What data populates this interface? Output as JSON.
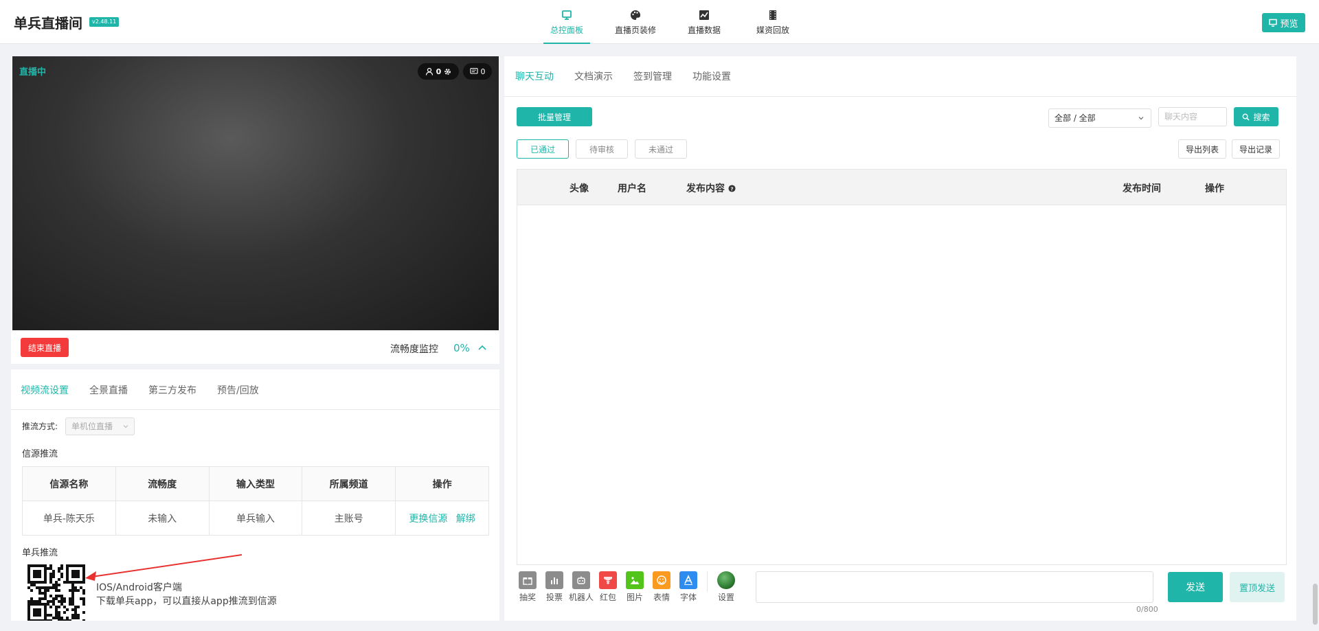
{
  "app": {
    "title": "单兵直播间",
    "version": "v2.48.11"
  },
  "nav": {
    "items": [
      {
        "label": "总控面板",
        "icon": "monitor-icon",
        "active": true
      },
      {
        "label": "直播页装修",
        "icon": "palette-icon",
        "active": false
      },
      {
        "label": "直播数据",
        "icon": "chart-icon",
        "active": false
      },
      {
        "label": "媒资回放",
        "icon": "film-icon",
        "active": false
      }
    ]
  },
  "header": {
    "preview_label": "预览"
  },
  "video": {
    "status": "直播中",
    "viewer_count": "0",
    "comment_count": "0",
    "end_live_label": "结束直播",
    "smoothness_label": "流畅度监控",
    "smoothness_value": "0%"
  },
  "settings": {
    "tabs": [
      "视频流设置",
      "全景直播",
      "第三方发布",
      "预告/回放"
    ],
    "push_method_label": "推流方式:",
    "push_method_value": "单机位直播",
    "source_push_title": "信源推流",
    "table": {
      "headers": [
        "信源名称",
        "流畅度",
        "输入类型",
        "所属频道",
        "操作"
      ],
      "rows": [
        {
          "name": "单兵-陈天乐",
          "smoothness": "未输入",
          "input_type": "单兵输入",
          "channel": "主账号",
          "actions": [
            "更换信源",
            "解绑"
          ]
        }
      ]
    },
    "solo_push_title": "单兵推流",
    "client_name": "IOS/Android客户端",
    "client_desc": "下载单兵app，可以直接从app推流到信源"
  },
  "chat": {
    "tabs": [
      "聊天互动",
      "文档演示",
      "签到管理",
      "功能设置"
    ],
    "batch_label": "批量管理",
    "filter_value": "全部 / 全部",
    "search_placeholder": "聊天内容",
    "search_label": "搜索",
    "status_filters": [
      "已通过",
      "待审核",
      "未通过"
    ],
    "export_list_label": "导出列表",
    "export_record_label": "导出记录",
    "columns": [
      "头像",
      "用户名",
      "发布内容",
      "发布时间",
      "操作"
    ],
    "tools": [
      {
        "label": "抽奖",
        "icon": "gift-icon",
        "color": "#8c8c8c"
      },
      {
        "label": "投票",
        "icon": "bar-chart-icon",
        "color": "#8c8c8c"
      },
      {
        "label": "机器人",
        "icon": "robot-icon",
        "color": "#8c8c8c"
      },
      {
        "label": "红包",
        "icon": "red-envelope-icon",
        "color": "#f04747"
      },
      {
        "label": "图片",
        "icon": "image-icon",
        "color": "#52c41a"
      },
      {
        "label": "表情",
        "icon": "emoji-icon",
        "color": "#fa9a1e"
      },
      {
        "label": "字体",
        "icon": "font-icon",
        "color": "#2d8cf0"
      }
    ],
    "settings_label": "设置",
    "char_count": "0/800",
    "send_label": "发送",
    "pin_send_label": "置顶发送"
  },
  "colors": {
    "accent": "#1fb5a9",
    "danger": "#f43b3b"
  }
}
